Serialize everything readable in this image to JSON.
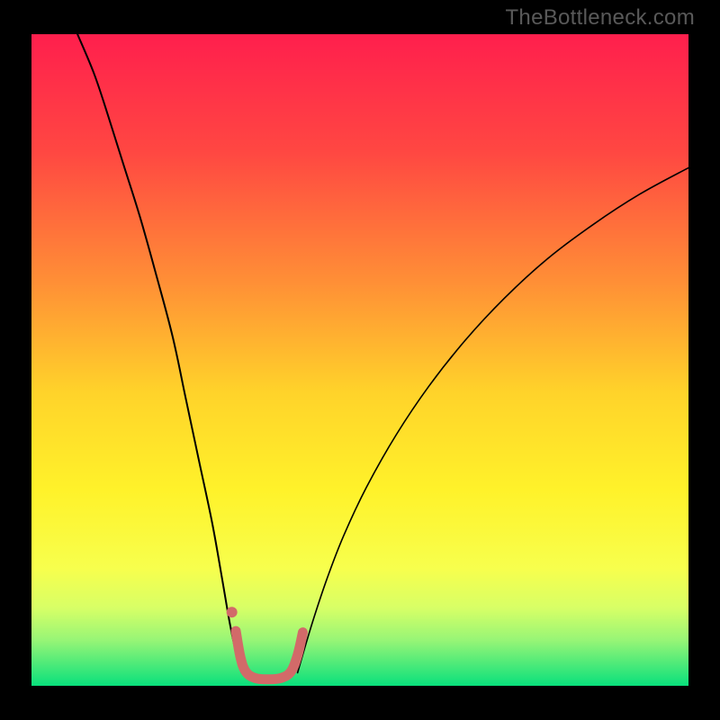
{
  "watermark": "TheBottleneck.com",
  "chart_data": {
    "type": "line",
    "title": "",
    "xlabel": "",
    "ylabel": "",
    "x_range": [
      0,
      1
    ],
    "y_range": [
      0,
      1
    ],
    "gradient_stops": [
      {
        "offset": 0.0,
        "color": "#ff1f4d"
      },
      {
        "offset": 0.18,
        "color": "#ff4742"
      },
      {
        "offset": 0.38,
        "color": "#ff8f36"
      },
      {
        "offset": 0.55,
        "color": "#ffd32a"
      },
      {
        "offset": 0.7,
        "color": "#fff22a"
      },
      {
        "offset": 0.82,
        "color": "#f7ff4d"
      },
      {
        "offset": 0.88,
        "color": "#d8ff66"
      },
      {
        "offset": 0.93,
        "color": "#97f576"
      },
      {
        "offset": 1.0,
        "color": "#09e07c"
      }
    ],
    "series": [
      {
        "name": "left-curve",
        "color": "#000000",
        "width": 2.0,
        "points": [
          {
            "x": 0.07,
            "y": 1.0
          },
          {
            "x": 0.095,
            "y": 0.94
          },
          {
            "x": 0.115,
            "y": 0.88
          },
          {
            "x": 0.14,
            "y": 0.8
          },
          {
            "x": 0.165,
            "y": 0.72
          },
          {
            "x": 0.19,
            "y": 0.63
          },
          {
            "x": 0.215,
            "y": 0.535
          },
          {
            "x": 0.235,
            "y": 0.44
          },
          {
            "x": 0.255,
            "y": 0.345
          },
          {
            "x": 0.275,
            "y": 0.25
          },
          {
            "x": 0.29,
            "y": 0.165
          },
          {
            "x": 0.302,
            "y": 0.095
          },
          {
            "x": 0.312,
            "y": 0.048
          },
          {
            "x": 0.32,
            "y": 0.02
          }
        ]
      },
      {
        "name": "right-curve",
        "color": "#000000",
        "width": 1.6,
        "points": [
          {
            "x": 0.405,
            "y": 0.02
          },
          {
            "x": 0.415,
            "y": 0.055
          },
          {
            "x": 0.43,
            "y": 0.105
          },
          {
            "x": 0.45,
            "y": 0.165
          },
          {
            "x": 0.475,
            "y": 0.23
          },
          {
            "x": 0.51,
            "y": 0.305
          },
          {
            "x": 0.555,
            "y": 0.385
          },
          {
            "x": 0.605,
            "y": 0.46
          },
          {
            "x": 0.66,
            "y": 0.53
          },
          {
            "x": 0.72,
            "y": 0.595
          },
          {
            "x": 0.785,
            "y": 0.655
          },
          {
            "x": 0.855,
            "y": 0.708
          },
          {
            "x": 0.925,
            "y": 0.754
          },
          {
            "x": 1.0,
            "y": 0.795
          }
        ]
      },
      {
        "name": "valley-highlight",
        "color": "#d26a69",
        "width": 11,
        "points": [
          {
            "x": 0.311,
            "y": 0.084
          },
          {
            "x": 0.318,
            "y": 0.044
          },
          {
            "x": 0.326,
            "y": 0.022
          },
          {
            "x": 0.34,
            "y": 0.012
          },
          {
            "x": 0.36,
            "y": 0.01
          },
          {
            "x": 0.38,
            "y": 0.012
          },
          {
            "x": 0.395,
            "y": 0.022
          },
          {
            "x": 0.405,
            "y": 0.047
          },
          {
            "x": 0.413,
            "y": 0.082
          }
        ]
      }
    ],
    "markers": [
      {
        "name": "left-dot",
        "x": 0.305,
        "y": 0.113,
        "r": 6,
        "color": "#d26a69"
      }
    ]
  }
}
